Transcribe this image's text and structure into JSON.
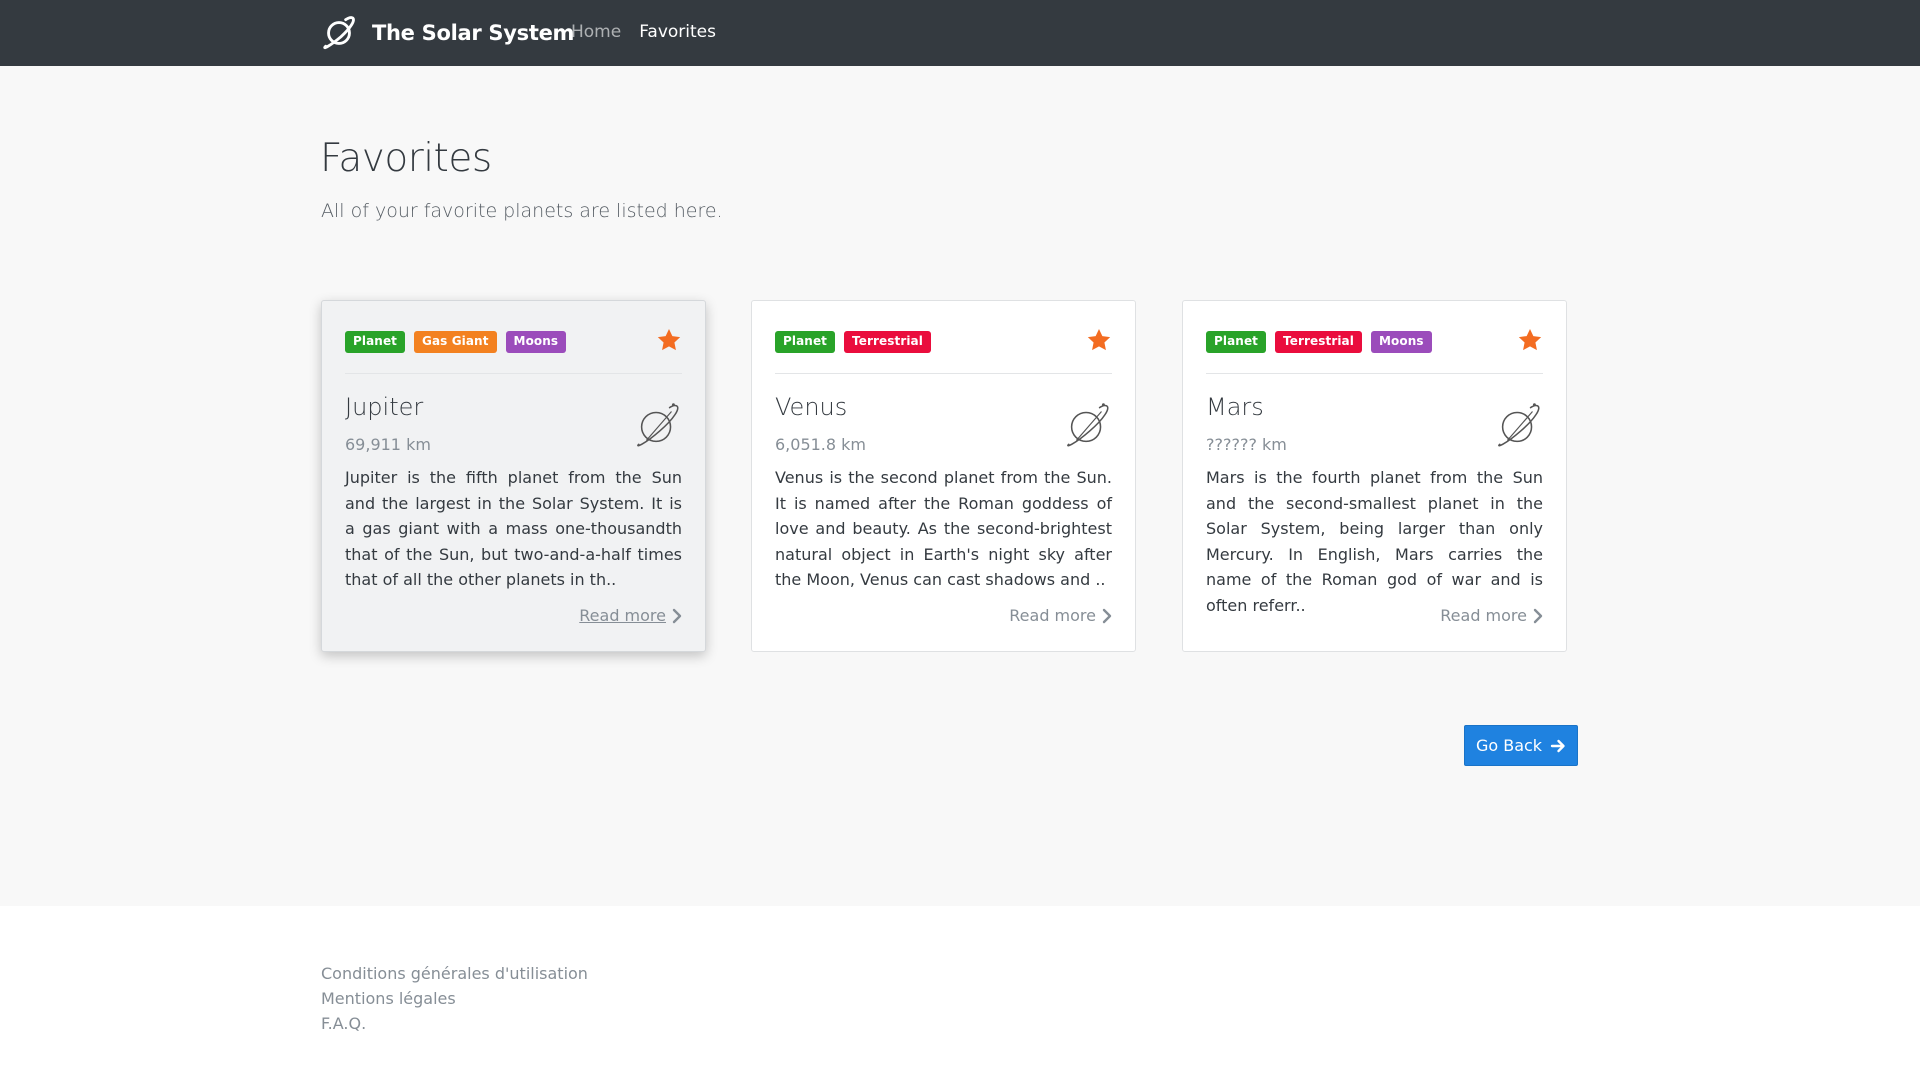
{
  "nav": {
    "brand": "The Solar System",
    "links": [
      {
        "label": "Home",
        "active": false
      },
      {
        "label": "Favorites",
        "active": true
      }
    ]
  },
  "header": {
    "title": "Favorites",
    "subtitle": "All of your favorite planets are listed here."
  },
  "cards": [
    {
      "name": "Jupiter",
      "size": "69,911 km",
      "tags": [
        "Planet",
        "Gas Giant",
        "Moons"
      ],
      "description": "Jupiter is the fifth planet from the Sun and the largest in the Solar System. It is a gas giant with a mass one-thousandth that of the Sun, but two-and-a-half times that of all the other planets in th..",
      "read_more": "Read more",
      "favorite": true
    },
    {
      "name": "Venus",
      "size": "6,051.8 km",
      "tags": [
        "Planet",
        "Terrestrial"
      ],
      "description": "Venus is the second planet from the Sun. It is named after the Roman goddess of love and beauty. As the second-brightest natural object in Earth's night sky after the Moon, Venus can cast shadows and ..",
      "read_more": "Read more",
      "favorite": true
    },
    {
      "name": "Mars",
      "size": "?????? km",
      "tags": [
        "Planet",
        "Terrestrial",
        "Moons"
      ],
      "description": "Mars is the fourth planet from the Sun and the second-smallest planet in the Solar System, being larger than only Mercury. In English, Mars carries the name of the Roman god of war and is often referr..",
      "read_more": "Read more",
      "favorite": true
    }
  ],
  "actions": {
    "go_back": "Go Back"
  },
  "footer": {
    "links": [
      "Conditions générales d'utilisation",
      "Mentions légales",
      "F.A.Q."
    ]
  },
  "colors": {
    "navbar": "#343a40",
    "tag_planet": "#29a329",
    "tag_gas_giant": "#f38120",
    "tag_moons": "#9b4cbb",
    "tag_terrestrial": "#ea0d3d",
    "star": "#f36c21",
    "primary_button": "#1f82e0"
  },
  "icons": {
    "brand": "planet-icon",
    "favorite": "star-icon",
    "card_planet": "planet-icon",
    "read_more": "chevron-right-icon",
    "go_back": "arrow-right-icon"
  }
}
